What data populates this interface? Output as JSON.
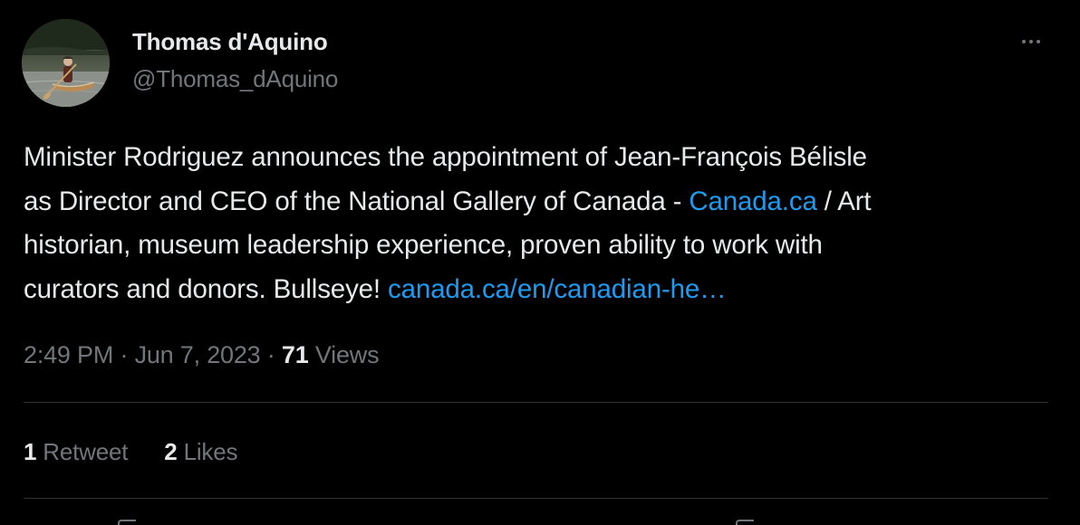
{
  "author": {
    "display_name": "Thomas d'Aquino",
    "handle": "@Thomas_dAquino",
    "avatar_icon": "person-in-canoe-avatar"
  },
  "menu": {
    "more_icon": "more-horizontal-icon"
  },
  "tweet": {
    "lines": [
      [
        {
          "text": "Minister Rodriguez announces the appointment of Jean-François Bélisle",
          "link": false
        }
      ],
      [
        {
          "text": "as Director and CEO of the National Gallery of Canada - ",
          "link": false
        },
        {
          "text": "Canada.ca",
          "link": true
        },
        {
          "text": " / Art",
          "link": false
        }
      ],
      [
        {
          "text": "historian, museum leadership experience, proven ability to work with",
          "link": false
        }
      ],
      [
        {
          "text": "curators and donors. Bullseye! ",
          "link": false
        },
        {
          "text": "canada.ca/en/canadian-he…",
          "link": true
        }
      ]
    ]
  },
  "meta": {
    "time": "2:49 PM",
    "separator": " · ",
    "date": "Jun 7, 2023",
    "views_count": "71",
    "views_label": " Views"
  },
  "stats": {
    "retweets": {
      "count": "1",
      "label": " Retweet"
    },
    "likes": {
      "count": "2",
      "label": " Likes"
    }
  },
  "colors": {
    "background": "#000000",
    "primary_text": "#e7e9ea",
    "secondary_text": "#71767b",
    "link": "#1d9bf0",
    "divider": "#2f3336"
  }
}
